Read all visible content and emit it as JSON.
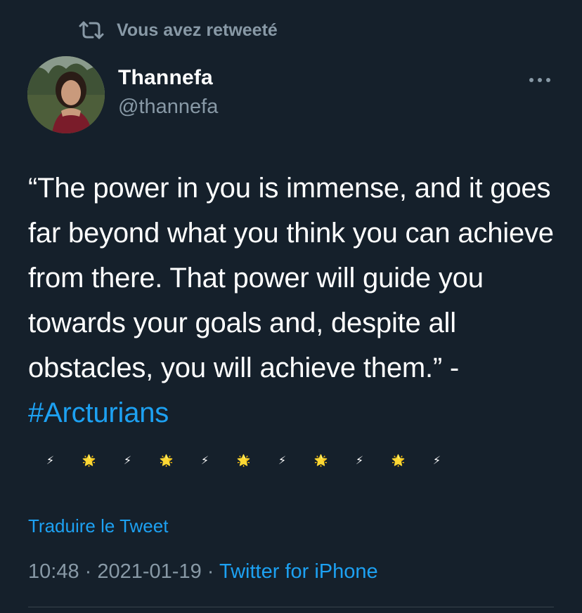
{
  "retweet_context": {
    "label": "Vous avez retweeté",
    "icon": "retweet-icon"
  },
  "author": {
    "display_name": "Thannefa",
    "handle": "@thannefa",
    "avatar": "avatar-photo"
  },
  "more_menu": {
    "icon": "more-horizontal-icon"
  },
  "tweet": {
    "text_before_hashtag": "“The power in you is immense, and it goes far beyond what you think you can achieve from there. That power will guide you towards your goals and, despite all obstacles, you will achieve them.” - ",
    "hashtag": "#Arcturians",
    "emojis": [
      "⚡",
      "🌟",
      "⚡",
      "🌟",
      "⚡",
      "🌟",
      "⚡",
      "🌟",
      "⚡",
      "🌟",
      "⚡"
    ]
  },
  "translate": {
    "label": "Traduire le Tweet"
  },
  "meta": {
    "time": "10:48",
    "separator": "·",
    "date": "2021-01-19",
    "source": "Twitter for iPhone"
  },
  "colors": {
    "background": "#15202b",
    "text_primary": "#ffffff",
    "text_secondary": "#8899a6",
    "link": "#1da1f2",
    "divider": "#38444d"
  }
}
